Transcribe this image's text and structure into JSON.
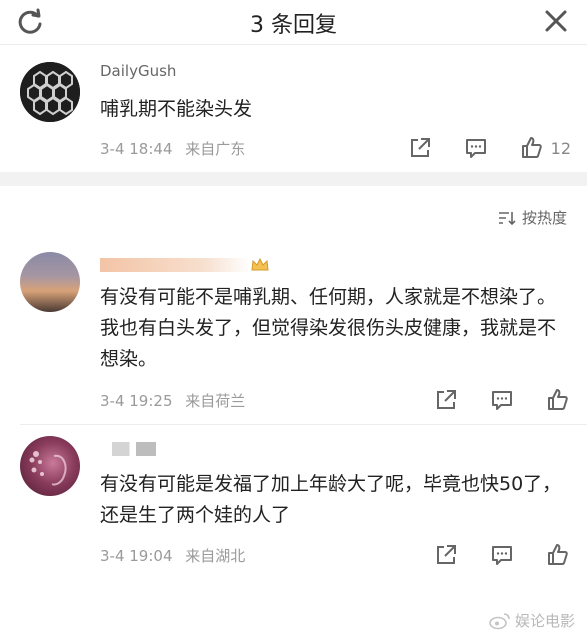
{
  "header": {
    "title": "3 条回复"
  },
  "root_comment": {
    "username": "DailyGush",
    "text": "哺乳期不能染头发",
    "time": "3-4 18:44",
    "location": "来自广东",
    "likes": "12"
  },
  "sort": {
    "label": "按热度"
  },
  "replies": [
    {
      "text": "有没有可能不是哺乳期、任何期，人家就是不想染了。我也有白头发了，但觉得染发很伤头皮健康，我就是不想染。",
      "time": "3-4 19:25",
      "location": "来自荷兰"
    },
    {
      "text": "有没有可能是发福了加上年龄大了呢，毕竟也快50了，还是生了两个娃的人了",
      "time": "3-4 19:04",
      "location": "来自湖北"
    }
  ],
  "watermark": {
    "text": "娱论电影"
  },
  "colors": {
    "meta_gray": "#9a9a9a",
    "separator": "#f2f2f2",
    "text": "#222222"
  }
}
